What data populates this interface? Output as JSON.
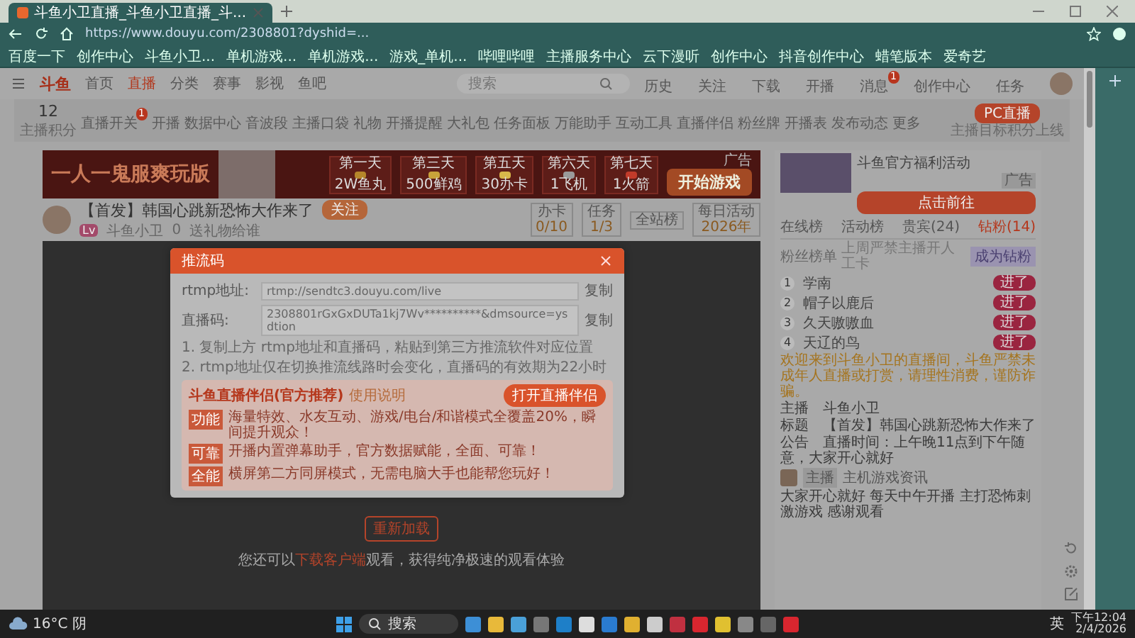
{
  "browser": {
    "tab_title": "斗鱼小卫直播_斗鱼小卫直播_斗...",
    "url": "https://www.douyu.com/2308801?dyshid=...",
    "bookmarks": [
      {
        "label": "百度一下"
      },
      {
        "label": "创作中心"
      },
      {
        "label": "斗鱼小卫..."
      },
      {
        "label": "单机游戏..."
      },
      {
        "label": "单机游戏..."
      },
      {
        "label": "游戏_单机..."
      },
      {
        "label": "哔哩哔哩"
      },
      {
        "label": "主播服务中心"
      },
      {
        "label": "云下漫听"
      },
      {
        "label": "创作中心"
      },
      {
        "label": "抖音创作中心"
      },
      {
        "label": "蜡笔版本"
      },
      {
        "label": "爱奇艺"
      }
    ]
  },
  "header": {
    "logo": "斗鱼",
    "nav": [
      {
        "label": "首页",
        "selected": false
      },
      {
        "label": "直播",
        "selected": true
      },
      {
        "label": "分类",
        "selected": false
      },
      {
        "label": "赛事",
        "selected": false
      },
      {
        "label": "影视",
        "selected": false
      },
      {
        "label": "鱼吧",
        "selected": false
      }
    ],
    "search": {
      "placeholder": "搜索"
    },
    "icons": [
      {
        "label": "历史"
      },
      {
        "label": "关注"
      },
      {
        "label": "下载"
      },
      {
        "label": "开播"
      },
      {
        "label": "消息",
        "badge": "1"
      },
      {
        "label": "创作中心"
      },
      {
        "label": "任务"
      }
    ]
  },
  "toolbar": {
    "score": "12",
    "score_label": "主播积分",
    "items": [
      {
        "label": "直播开关",
        "badge": "1"
      },
      {
        "label": "开播"
      },
      {
        "label": "数据中心"
      },
      {
        "label": "音波段"
      },
      {
        "label": "主播口袋"
      },
      {
        "label": "礼物"
      },
      {
        "label": "开播提醒"
      },
      {
        "label": "大礼包"
      },
      {
        "label": "任务面板"
      },
      {
        "label": "万能助手"
      },
      {
        "label": "互动工具"
      },
      {
        "label": "直播伴侣"
      },
      {
        "label": "粉丝牌"
      },
      {
        "label": "开播表"
      },
      {
        "label": "发布动态"
      },
      {
        "label": "更多"
      }
    ],
    "pc_button": "PC直播",
    "pc_note": "主播目标积分上线"
  },
  "banner": {
    "slogan": "一人一鬼服爽玩版",
    "ad": "广告",
    "days": [
      {
        "day": "第一天",
        "prize": "2W鱼丸"
      },
      {
        "day": "第三天",
        "prize": "500鲜鸡"
      },
      {
        "day": "第五天",
        "prize": "30办卡"
      },
      {
        "day": "第六天",
        "prize": "1飞机"
      },
      {
        "day": "第七天",
        "prize": "1火箭"
      }
    ],
    "cta": "开始游戏"
  },
  "stream": {
    "title": "【首发】韩国心跳新恐怖大作来了",
    "follow": "关注",
    "level": "Lv",
    "host": "斗鱼小卫",
    "count": "0",
    "report": "送礼物给谁",
    "stats": [
      {
        "label": "办卡",
        "value": "0/10"
      },
      {
        "label": "任务",
        "value": "1/3"
      },
      {
        "label": "全站榜"
      },
      {
        "label": "每日活动",
        "value": "2026年"
      }
    ]
  },
  "player": {
    "reload": "重新加载",
    "tip_before": "您还可以",
    "tip_link": "下载客户端",
    "tip_after": "观看，获得纯净极速的观看体验"
  },
  "modal": {
    "title": "推流码",
    "rows": [
      {
        "label": "rtmp地址:",
        "value": "rtmp://sendtc3.douyu.com/live",
        "copy": "复制"
      },
      {
        "label": "直播码:",
        "value": "2308801rGxGxDUTa1kj7Wv**********&dmsource=ysdtion",
        "copy": "复制"
      }
    ],
    "notes": [
      "1. 复制上方 rtmp地址和直播码，粘贴到第三方推流软件对应位置",
      "2. rtmp地址仅在切换推流线路时会变化，直播码的有效期为22小时"
    ],
    "promo": {
      "title": "斗鱼直播伴侣(官方推荐)",
      "guide": "使用说明",
      "button": "打开直播伴侣",
      "features": [
        {
          "tag": "功能",
          "text": "海量特效、水友互动、游戏/电台/和谐模式全覆盖20%，瞬间提升观众！"
        },
        {
          "tag": "可靠",
          "text": "开播内置弹幕助手，官方数据赋能，全面、可靠！"
        },
        {
          "tag": "全能",
          "text": "横屏第二方同屏模式，无需电脑大手也能帮您玩好！"
        }
      ]
    }
  },
  "sidebar": {
    "ad": {
      "title": "斗鱼官方福利活动",
      "badge": "广告",
      "button": "点击前往"
    },
    "tabs": [
      {
        "label": "在线榜",
        "selected": false
      },
      {
        "label": "活动榜",
        "selected": false
      },
      {
        "label": "贵宾(24)",
        "selected": false
      },
      {
        "label": "钻粉(14)",
        "selected": true
      }
    ],
    "rank_header": {
      "label": "粉丝榜单",
      "note": "上周严禁主播开人工卡",
      "button": "成为钻粉"
    },
    "ranks": [
      {
        "index": "1",
        "name": "学南",
        "badge": "进了"
      },
      {
        "index": "2",
        "name": "帽子以鹿后",
        "badge": "进了"
      },
      {
        "index": "3",
        "name": "久天嗷嗷血",
        "badge": "进了"
      },
      {
        "index": "4",
        "name": "天辽的鸟",
        "badge": "进了"
      }
    ],
    "notice": "欢迎来到斗鱼小卫的直播间，斗鱼严禁未成年人直播或打赏，请理性消费，谨防诈骗。",
    "info": [
      {
        "key": "主播",
        "value": "斗鱼小卫"
      },
      {
        "key": "标题",
        "value": "【首发】韩国心跳新恐怖大作来了"
      },
      {
        "key": "公告",
        "value": "直播时间：上午晚11点到下午随意，大家开心就好"
      }
    ],
    "user": {
      "tag": "主播",
      "name": "主机游戏资讯"
    },
    "comment": "大家开心就好 每天中午开播 主打恐怖刺激游戏 感谢观看"
  },
  "taskbar": {
    "temp": "16°C",
    "weather": "阴",
    "search": "搜索",
    "lang": "英",
    "time": "下午12:04",
    "date": "2/4/2026"
  }
}
